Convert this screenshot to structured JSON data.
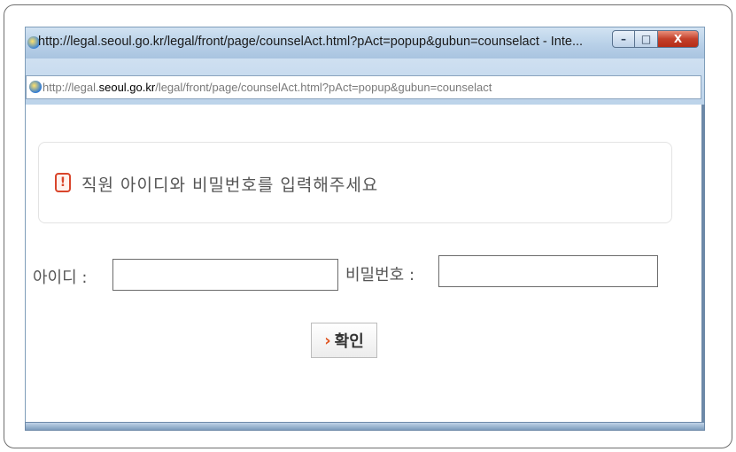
{
  "window": {
    "title": "http://legal.seoul.go.kr/legal/front/page/counselAct.html?pAct=popup&gubun=counselact - Inte...",
    "icon": "ie-icon",
    "controls": {
      "minimize": "–",
      "maximize": "□",
      "close": "X"
    }
  },
  "address_bar": {
    "protocol": "http://legal.",
    "host": "seoul.go.kr",
    "path": "/legal/front/page/counselAct.html?pAct=popup&gubun=counselact"
  },
  "message": {
    "icon": "warning-icon",
    "icon_glyph": "!",
    "text": "직원 아이디와 비밀번호를 입력해주세요"
  },
  "form": {
    "id_label": "아이디 :",
    "id_value": "",
    "pw_label": "비밀번호 :",
    "pw_value": "",
    "submit_arrow": "›",
    "submit_label": "확인"
  },
  "colors": {
    "accent_arrow": "#e0531f",
    "warning": "#d9452b",
    "titlebar": "#b8d0e8"
  }
}
